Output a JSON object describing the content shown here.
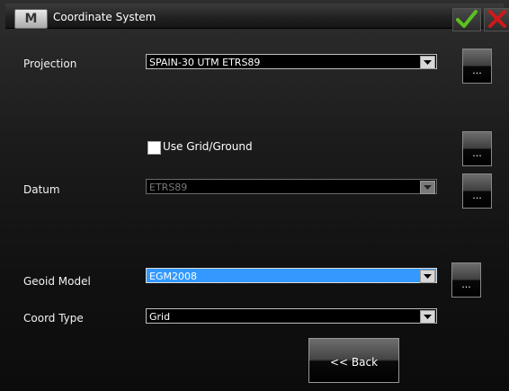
{
  "window": {
    "logo": "M",
    "title": "Coordinate System",
    "ok_icon": "check-icon",
    "cancel_icon": "close-icon",
    "ok_color": "#5cc11f",
    "cancel_color": "#d01818"
  },
  "form": {
    "projection": {
      "label": "Projection",
      "value": "SPAIN-30 UTM ETRS89",
      "button": "..."
    },
    "grid_ground": {
      "label": "Use Grid/Ground",
      "checked": false,
      "button": "..."
    },
    "datum": {
      "label": "Datum",
      "value": "ETRS89",
      "disabled": true,
      "button": "..."
    },
    "geoid": {
      "label": "Geoid Model",
      "value": "EGM2008",
      "button": "..."
    },
    "coord_type": {
      "label": "Coord Type",
      "value": "Grid"
    }
  },
  "footer": {
    "back_label": "<< Back"
  },
  "colors": {
    "selected_highlight": "#3399ff"
  }
}
